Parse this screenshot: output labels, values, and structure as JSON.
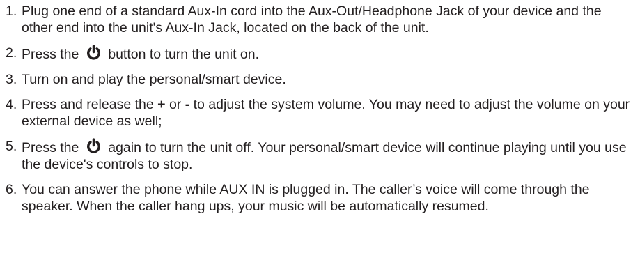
{
  "steps": [
    {
      "number": "1.",
      "text": "Plug one end of a standard Aux-In cord into the Aux-Out/Headphone Jack of your device and the other end into the unit's Aux-In Jack, located on the back of the unit."
    },
    {
      "number": "2.",
      "before": "Press the",
      "icon": "power-icon",
      "after": "button to turn the unit on."
    },
    {
      "number": "3.",
      "text": "Turn on and play the personal/smart device."
    },
    {
      "number": "4.",
      "before": "Press and release the",
      "plus": "+",
      "or": "or",
      "minus": "-",
      "after": "to adjust the system volume. You may need to adjust the volume on your external device as well;"
    },
    {
      "number": "5.",
      "before": "Press the",
      "icon": "power-icon",
      "after": "again to turn the unit off.  Your personal/smart device will continue playing until you use the device's controls to stop."
    },
    {
      "number": "6.",
      "text": "You can answer the phone while AUX IN is plugged in. The caller’s voice will come through the speaker. When the caller hang ups, your music will be automatically resumed."
    }
  ]
}
